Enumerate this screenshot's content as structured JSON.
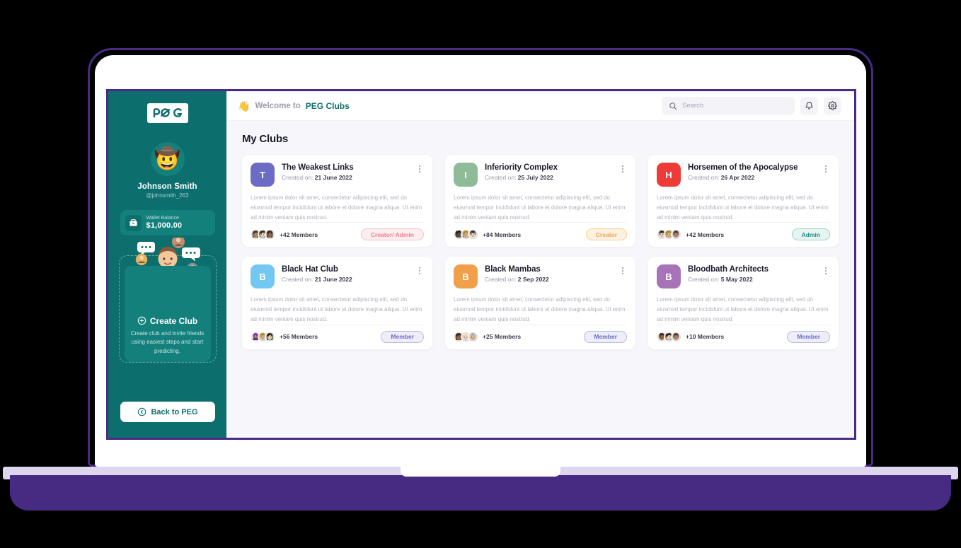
{
  "sidebar": {
    "logo_text": "PEG",
    "avatar_icon": "cowboy-hat-face-avatar",
    "user_name": "Johnson Smith",
    "user_handle": "@johnsmith_263",
    "wallet": {
      "icon": "wallet-icon",
      "label": "Wallet Balance",
      "amount": "$1,000.00"
    },
    "create_club": {
      "icon": "plus-circle-icon",
      "title": "Create Club",
      "description": "Create club and invite friends using easiest steps and start predicting."
    },
    "back_button": {
      "icon": "chevron-left-circle-icon",
      "label": "Back to PEG"
    }
  },
  "topbar": {
    "wave_emoji": "👋",
    "welcome_prefix": "Welcome to",
    "welcome_brand": "PEG Clubs",
    "search": {
      "icon": "search-icon",
      "placeholder": "Search",
      "value": ""
    },
    "notification_icon": "bell-icon",
    "settings_icon": "gear-icon"
  },
  "main": {
    "page_title": "My Clubs",
    "created_prefix": "Created on:",
    "members_suffix": "Members",
    "clubs": [
      {
        "initial": "T",
        "badge_color": "#6c6cc4",
        "name": "The Weakest Links",
        "created_on": "21 June 2022",
        "description": "Lorem ipsum dolor sit amet, consectetur adipiscing elit, sed do eiusmod tempor incididunt ut labore et dolore magna aliqua. Ut enim ad minim veniam quis nostrud.",
        "members": "+42",
        "avatars": [
          "👩🏽",
          "🧑🏻",
          "👩🏾"
        ],
        "role": "Creator/ Admin",
        "role_text_color": "#f07f8f",
        "role_bg_color": "#fdeef0",
        "role_border_color": "#f7c3cb"
      },
      {
        "initial": "I",
        "badge_color": "#8ebb98",
        "name": "Inferiority Complex",
        "created_on": "25 July 2022",
        "description": "Lorem ipsum dolor sit amet, consectetur adipiscing elit, sed do eiusmod tempor incididunt ut labore et dolore magna aliqua. Ut enim ad minim veniam quis nostrud.",
        "members": "+84",
        "avatars": [
          "🧑🏿",
          "👩🏼",
          "👨🏻"
        ],
        "role": "Creator",
        "role_text_color": "#eda44a",
        "role_bg_color": "#fdf2e2",
        "role_border_color": "#f6cf93"
      },
      {
        "initial": "H",
        "badge_color": "#ef3b38",
        "name": "Horsemen of the Apocalypse",
        "created_on": "26 Apr 2022",
        "description": "Lorem ipsum dolor sit amet, consectetur adipiscing elit, sed do eiusmod tempor incididunt ut labore et dolore magna aliqua. Ut enim ad minim veniam quis nostrud.",
        "members": "+42",
        "avatars": [
          "👨🏻",
          "🧑🏼",
          "👨🏽"
        ],
        "role": "Admin",
        "role_text_color": "#1f8d85",
        "role_bg_color": "#e6f4f2",
        "role_border_color": "#9ed3cd"
      },
      {
        "initial": "B",
        "badge_color": "#72c8f2",
        "name": "Black Hat Club",
        "created_on": "21 June 2022",
        "description": "Lorem ipsum dolor sit amet, consectetur adipiscing elit, sed do eiusmod tempor incididunt ut labore et dolore magna aliqua. Ut enim ad minim veniam quis nostrud.",
        "members": "+56",
        "avatars": [
          "🧕🏽",
          "👨🏼",
          "👩🏻"
        ],
        "role": "Member",
        "role_text_color": "#6c6cc4",
        "role_bg_color": "#eeeefb",
        "role_border_color": "#b9b9e8"
      },
      {
        "initial": "B",
        "badge_color": "#f1a049",
        "name": "Black Mambas",
        "created_on": "2 Sep 2022",
        "description": "Lorem ipsum dolor sit amet, consectetur adipiscing elit, sed do eiusmod tempor incididunt ut labore et dolore magna aliqua. Ut enim ad minim veniam quis nostrud.",
        "members": "+25",
        "avatars": [
          "👩🏾",
          "👴🏻",
          "👵🏼"
        ],
        "role": "Member",
        "role_text_color": "#6c6cc4",
        "role_bg_color": "#eeeefb",
        "role_border_color": "#b9b9e8"
      },
      {
        "initial": "B",
        "badge_color": "#a874b8",
        "name": "Bloodbath Architects",
        "created_on": "5 May 2022",
        "description": "Lorem ipsum dolor sit amet, consectetur adipiscing elit, sed do eiusmod tempor incididunt ut labore et dolore magna aliqua. Ut enim ad minim veniam quis nostrud.",
        "members": "+10",
        "avatars": [
          "👨🏾",
          "🧑🏻",
          "👨🏽"
        ],
        "role": "Member",
        "role_text_color": "#6c6cc4",
        "role_bg_color": "#eeeefb",
        "role_border_color": "#b9b9e8"
      }
    ]
  },
  "theme": {
    "sidebar_bg": "#0d6e6e",
    "accent_teal": "#0d6e6e",
    "laptop_purple": "#472b82",
    "content_bg": "#f7f7fb"
  }
}
